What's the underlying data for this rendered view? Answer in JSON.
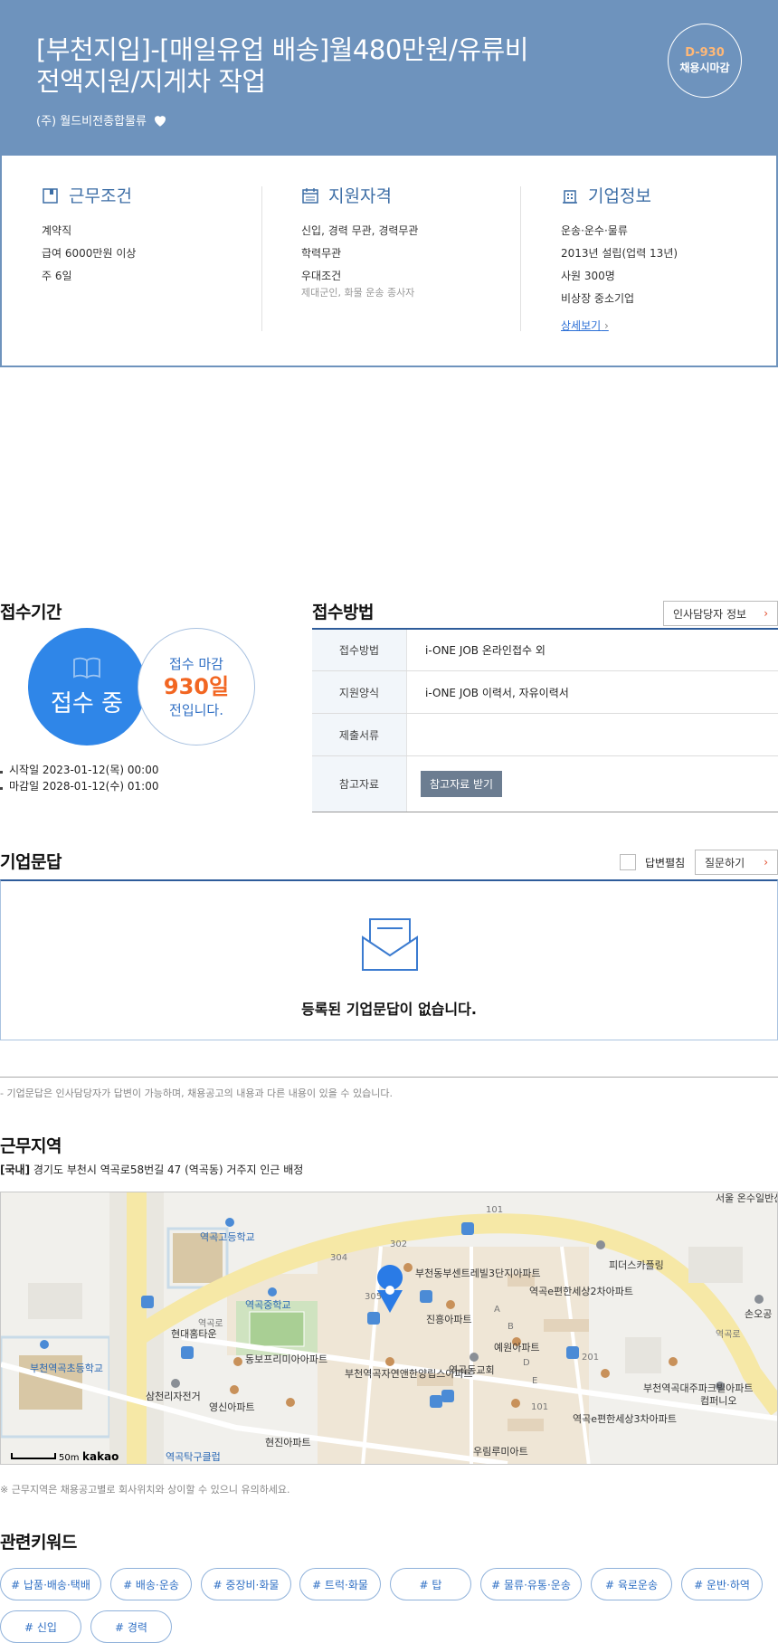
{
  "header": {
    "title_line1": "[부천지입]-[매일유업 배송]월480만원/유류비",
    "title_line2": "전액지원/지게차 작업",
    "company": "(주) 월드비전종합물류",
    "dday": "D-930",
    "dday_label": "채용시마감"
  },
  "conditions": {
    "title": "근무조건",
    "items": [
      "계약직",
      "급여 6000만원 이상",
      "주 6일"
    ]
  },
  "qualifications": {
    "title": "지원자격",
    "items": [
      "신입, 경력 무관, 경력무관",
      "학력무관",
      "우대조건"
    ],
    "preferred": "제대군인, 화물 운송 종사자"
  },
  "company_info": {
    "title": "기업정보",
    "items": [
      "운송·운수·물류",
      "2013년 설립(업력 13년)",
      "사원 300명",
      "비상장 중소기업"
    ],
    "detail_link": "상세보기"
  },
  "period": {
    "title": "접수기간",
    "status": "접수 중",
    "deadline_label": "접수 마감",
    "days": "930일",
    "deadline_suffix": "전입니다.",
    "start": "시작일 2023-01-12(목) 00:00",
    "end": "마감일 2028-01-12(수) 01:00"
  },
  "method": {
    "title": "접수방법",
    "hr_button": "인사담당자 정보",
    "rows": [
      {
        "label": "접수방법",
        "value": "i-ONE JOB 온라인접수 외"
      },
      {
        "label": "지원양식",
        "value": "i-ONE JOB 이력서, 자유이력서"
      },
      {
        "label": "제출서류",
        "value": ""
      },
      {
        "label": "참고자료",
        "value": "참고자료 받기"
      }
    ]
  },
  "qa": {
    "title": "기업문답",
    "expand_label": "답변펼침",
    "ask_button": "질문하기",
    "empty": "등록된 기업문답이 없습니다.",
    "note": "- 기업문답은 인사담당자가 답변이 가능하며, 채용공고의 내용과 다른 내용이 있을 수 있습니다."
  },
  "location": {
    "title": "근무지역",
    "region": "[국내]",
    "address": "경기도 부천시 역곡로58번길 47 (역곡동) 거주지 인근 배정",
    "note": "※ 근무지역은 채용공고별로 회사위치와 상이할 수 있으니 유의하세요.",
    "map_scale": "50m",
    "map_brand": "kakao",
    "map_labels": [
      "역곡고등학교",
      "역곡중학교",
      "부천역곡초등학교",
      "현대홈타운",
      "동보프리미아아파트",
      "삼천리자전거",
      "영신아파트",
      "역곡탁구클럽",
      "현진아파트",
      "부천동부센트레빌3단지아파트",
      "진흥아파트",
      "역곡e편한세상2차아파트",
      "예원아파트",
      "역곡동교회",
      "부천역곡자연앤한양립스아파트",
      "역곡e편한세상3차아파트",
      "우림루미아트",
      "피더스카플링",
      "부천역곡대주파크빌아파트",
      "컴퍼니오",
      "손오공",
      "서울 온수일반산업단지",
      "역곡로",
      "역곡로"
    ]
  },
  "keywords": {
    "title": "관련키워드",
    "items": [
      "# 납품·배송·택배",
      "# 배송·운송",
      "# 중장비·화물",
      "# 트럭·화물",
      "# 탑",
      "# 물류·유통·운송",
      "# 육로운송",
      "# 운반·하역",
      "# 신입",
      "# 경력"
    ]
  }
}
